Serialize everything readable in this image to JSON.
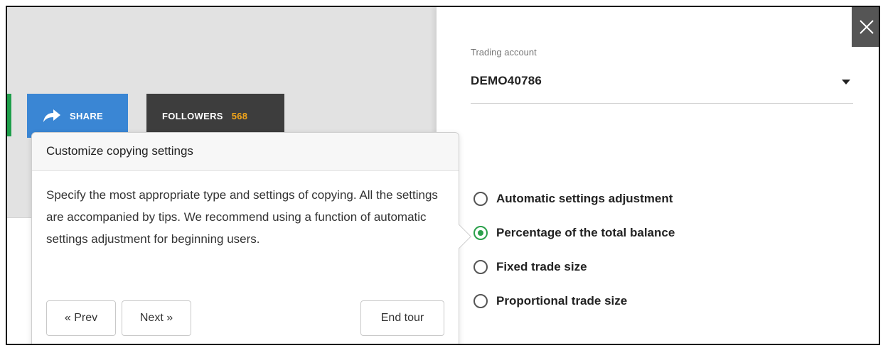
{
  "toolbar": {
    "share_label": "SHARE",
    "followers_label": "FOLLOWERS",
    "followers_count": "568"
  },
  "tour": {
    "title": "Customize copying settings",
    "body": "Specify the most appropriate type and settings of copying. All the settings are accompanied by tips. We recommend using a function of automatic settings adjustment for beginning users.",
    "prev_label": "« Prev",
    "next_label": "Next »",
    "end_label": "End tour"
  },
  "settings": {
    "account_label": "Trading account",
    "account_value": "DEMO40786",
    "options": [
      {
        "label": "Automatic settings adjustment",
        "selected": false
      },
      {
        "label": "Percentage of the total balance",
        "selected": true
      },
      {
        "label": "Fixed trade size",
        "selected": false
      },
      {
        "label": "Proportional trade size",
        "selected": false
      }
    ]
  },
  "colors": {
    "share_button": "#3a86d4",
    "followers_button": "#3d3d3d",
    "followers_count": "#f2a51a",
    "radio_selected": "#2aa04a",
    "close_button": "#555555"
  },
  "icons": [
    "share-arrow-icon",
    "close-icon",
    "caret-down-icon"
  ]
}
